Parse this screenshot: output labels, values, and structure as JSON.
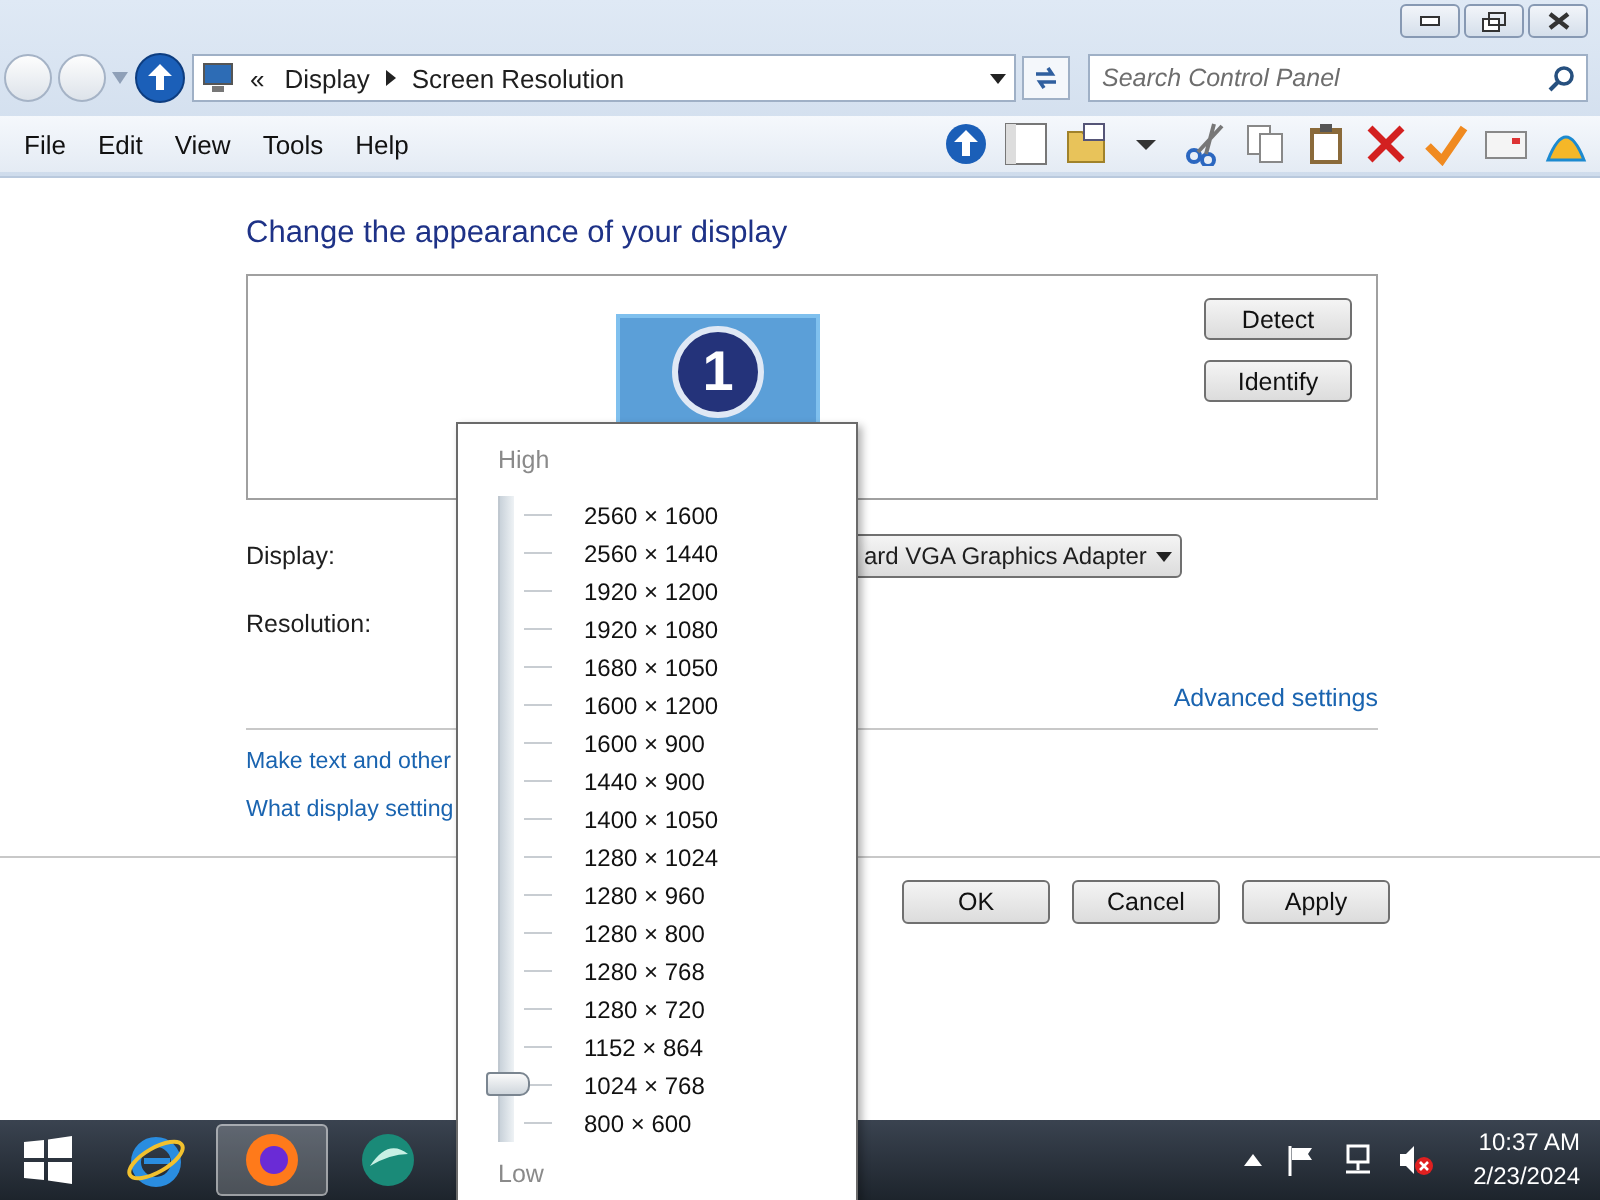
{
  "address_bar": {
    "prefix": "«",
    "breadcrumbs": [
      "Display",
      "Screen Resolution"
    ]
  },
  "search": {
    "placeholder": "Search Control Panel"
  },
  "menu": [
    "File",
    "Edit",
    "View",
    "Tools",
    "Help"
  ],
  "heading": "Change the appearance of your display",
  "monitor": {
    "number": "1"
  },
  "side_buttons": [
    "Detect",
    "Identify"
  ],
  "display_field": {
    "label": "Display:",
    "value": "ard VGA Graphics Adapter"
  },
  "resolution_field": {
    "label": "Resolution:"
  },
  "advanced_link": "Advanced settings",
  "links": [
    "Make text and other",
    "What display setting"
  ],
  "dialog_buttons": [
    "OK",
    "Cancel",
    "Apply"
  ],
  "resolution_popup": {
    "high": "High",
    "low": "Low",
    "level": 0.0625,
    "options": [
      "2560 × 1600",
      "2560 × 1440",
      "1920 × 1200",
      "1920 × 1080",
      "1680 × 1050",
      "1600 × 1200",
      "1600 × 900",
      "1440 × 900",
      "1400 × 1050",
      "1280 × 1024",
      "1280 × 960",
      "1280 × 800",
      "1280 × 768",
      "1280 × 720",
      "1152 × 864",
      "1024 × 768",
      "800 × 600"
    ]
  },
  "taskbar": {
    "apps": [
      {
        "kind": "ie",
        "selected": false
      },
      {
        "kind": "firefox",
        "selected": true
      },
      {
        "kind": "teal",
        "selected": false
      }
    ],
    "clock": {
      "time": "10:37 AM",
      "date": "2/23/2024"
    }
  }
}
